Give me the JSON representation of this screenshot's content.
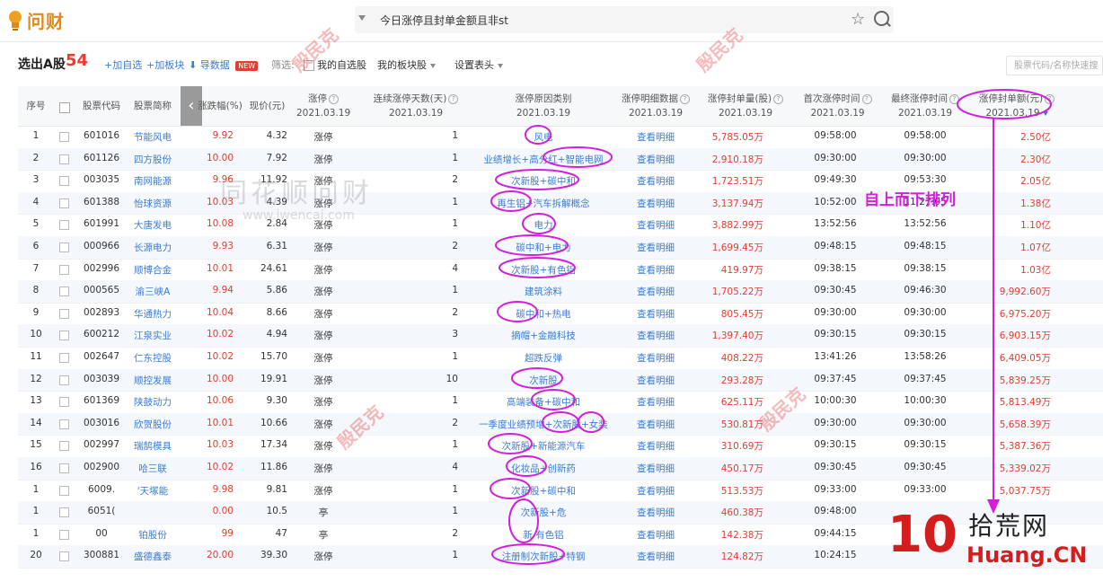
{
  "header": {
    "logo_text": "问财",
    "search_query": "今日涨停且封单金额且非st"
  },
  "toolbar": {
    "title": "选出A股",
    "count": "54",
    "add_watchlist": "+加自选",
    "add_block": "+加板块",
    "export": "导数据",
    "new_badge": "NEW",
    "filter_label": "筛选:",
    "my_watchlist": "我的自选股",
    "my_blocks": "我的板块股",
    "table_settings": "设置表头",
    "quick_search_placeholder": "股票代码/名称快速搜"
  },
  "columns": [
    {
      "label": "序号"
    },
    {
      "label": "股票代码"
    },
    {
      "label": "股票简称"
    },
    {
      "label": "涨跌幅(%)"
    },
    {
      "label": "现价(元)"
    },
    {
      "label": "涨停",
      "date": "2021.03.19"
    },
    {
      "label": "连续涨停天数(天)",
      "date": "2021.03.19"
    },
    {
      "label": "涨停原因类别",
      "date": "2021.03.19"
    },
    {
      "label": "涨停明细数据",
      "date": "2021.03.19"
    },
    {
      "label": "涨停封单量(股)",
      "date": "2021.03.19"
    },
    {
      "label": "首次涨停时间",
      "date": "2021.03.19"
    },
    {
      "label": "最终涨停时间",
      "date": "2021.03.19"
    },
    {
      "label": "涨停封单额(元)",
      "date": "2021.03.19"
    }
  ],
  "rows": [
    {
      "idx": "1",
      "code": "601016",
      "name": "节能风电",
      "chg": "9.92",
      "price": "4.32",
      "status": "涨停",
      "days": "1",
      "reason": "风电",
      "detail": "查看明细",
      "vol": "5,785.05万",
      "first": "09:58:00",
      "last": "09:58:00",
      "amount": "2.50亿"
    },
    {
      "idx": "2",
      "code": "601126",
      "name": "四方股份",
      "chg": "10.00",
      "price": "7.92",
      "status": "涨停",
      "days": "1",
      "reason": "业绩增长+高分红+智能电网",
      "detail": "查看明细",
      "vol": "2,910.18万",
      "first": "09:30:00",
      "last": "09:30:00",
      "amount": "2.30亿"
    },
    {
      "idx": "3",
      "code": "003035",
      "name": "南网能源",
      "chg": "9.96",
      "price": "11.92",
      "status": "涨停",
      "days": "2",
      "reason": "次新股+碳中和",
      "detail": "查看明细",
      "vol": "1,723.51万",
      "first": "09:49:30",
      "last": "09:53:30",
      "amount": "2.05亿"
    },
    {
      "idx": "4",
      "code": "601388",
      "name": "怡球资源",
      "chg": "10.03",
      "price": "4.39",
      "status": "涨停",
      "days": "1",
      "reason": "再生铝+汽车拆解概念",
      "detail": "查看明细",
      "vol": "3,137.94万",
      "first": "10:52:00",
      "last": "11:27:05",
      "amount": "1.38亿"
    },
    {
      "idx": "5",
      "code": "601991",
      "name": "大唐发电",
      "chg": "10.08",
      "price": "2.84",
      "status": "涨停",
      "days": "1",
      "reason": "电力",
      "detail": "查看明细",
      "vol": "3,882.99万",
      "first": "13:52:56",
      "last": "13:52:56",
      "amount": "1.10亿"
    },
    {
      "idx": "6",
      "code": "000966",
      "name": "长源电力",
      "chg": "9.93",
      "price": "6.31",
      "status": "涨停",
      "days": "2",
      "reason": "碳中和+电力",
      "detail": "查看明细",
      "vol": "1,699.45万",
      "first": "09:48:15",
      "last": "09:48:15",
      "amount": "1.07亿"
    },
    {
      "idx": "7",
      "code": "002996",
      "name": "顺博合金",
      "chg": "10.01",
      "price": "24.61",
      "status": "涨停",
      "days": "4",
      "reason": "次新股+有色铝",
      "detail": "查看明细",
      "vol": "419.97万",
      "first": "09:38:15",
      "last": "09:38:15",
      "amount": "1.03亿"
    },
    {
      "idx": "8",
      "code": "000565",
      "name": "渝三峡A",
      "chg": "9.94",
      "price": "5.86",
      "status": "涨停",
      "days": "1",
      "reason": "建筑涂料",
      "detail": "查看明细",
      "vol": "1,705.22万",
      "first": "09:30:45",
      "last": "09:46:30",
      "amount": "9,992.60万"
    },
    {
      "idx": "9",
      "code": "002893",
      "name": "华通热力",
      "chg": "10.04",
      "price": "8.66",
      "status": "涨停",
      "days": "2",
      "reason": "碳中和+热电",
      "detail": "查看明细",
      "vol": "805.45万",
      "first": "09:30:00",
      "last": "09:30:00",
      "amount": "6,975.20万"
    },
    {
      "idx": "10",
      "code": "600212",
      "name": "江泉实业",
      "chg": "10.02",
      "price": "4.94",
      "status": "涨停",
      "days": "3",
      "reason": "摘帽+金融科技",
      "detail": "查看明细",
      "vol": "1,397.40万",
      "first": "09:30:15",
      "last": "09:30:15",
      "amount": "6,903.15万"
    },
    {
      "idx": "11",
      "code": "002647",
      "name": "仁东控股",
      "chg": "10.02",
      "price": "15.70",
      "status": "涨停",
      "days": "1",
      "reason": "超跌反弹",
      "detail": "查看明细",
      "vol": "408.22万",
      "first": "13:41:26",
      "last": "13:58:26",
      "amount": "6,409.05万"
    },
    {
      "idx": "12",
      "code": "003039",
      "name": "顺控发展",
      "chg": "10.00",
      "price": "19.91",
      "status": "涨停",
      "days": "10",
      "reason": "次新股",
      "detail": "查看明细",
      "vol": "293.28万",
      "first": "09:37:45",
      "last": "09:37:45",
      "amount": "5,839.25万"
    },
    {
      "idx": "13",
      "code": "601369",
      "name": "陕鼓动力",
      "chg": "10.06",
      "price": "9.30",
      "status": "涨停",
      "days": "1",
      "reason": "高端装备+碳中和",
      "detail": "查看明细",
      "vol": "625.11万",
      "first": "10:00:30",
      "last": "10:00:30",
      "amount": "5,813.49万"
    },
    {
      "idx": "14",
      "code": "003016",
      "name": "欣贺股份",
      "chg": "10.01",
      "price": "10.66",
      "status": "涨停",
      "days": "2",
      "reason": "一季度业绩预增+次新股+女装",
      "detail": "查看明细",
      "vol": "530.81万",
      "first": "09:30:00",
      "last": "09:30:00",
      "amount": "5,658.39万"
    },
    {
      "idx": "15",
      "code": "002997",
      "name": "瑞鹄模具",
      "chg": "10.03",
      "price": "17.34",
      "status": "涨停",
      "days": "1",
      "reason": "次新股+新能源汽车",
      "detail": "查看明细",
      "vol": "310.69万",
      "first": "09:30:15",
      "last": "09:30:15",
      "amount": "5,387.36万"
    },
    {
      "idx": "16",
      "code": "002900",
      "name": "哈三联",
      "chg": "10.02",
      "price": "11.86",
      "status": "涨停",
      "days": "4",
      "reason": "化妆品+创新药",
      "detail": "查看明细",
      "vol": "450.17万",
      "first": "09:30:45",
      "last": "09:30:45",
      "amount": "5,339.02万"
    },
    {
      "idx": "1",
      "code": "6009.",
      "name": "'天塚能",
      "chg": "9.98",
      "price": "9.81",
      "status": "涨停",
      "days": "1",
      "reason": "次新股+碳中和",
      "detail": "查看明细",
      "vol": "513.53万",
      "first": "09:33:00",
      "last": "09:33:00",
      "amount": "5,037.75万"
    },
    {
      "idx": "1",
      "code": "6051(",
      "name": "",
      "chg": "0.00",
      "price": "10.5",
      "status": "亭",
      "days": "1",
      "reason": "次新股+危",
      "detail": "查看明细",
      "vol": "460.38万",
      "first": "09:48:00",
      "last": "",
      "amount": ""
    },
    {
      "idx": "1",
      "code": "00",
      "name": "铂股份",
      "chg": "99",
      "price": "47",
      "status": "亭",
      "days": "2",
      "reason": "新 有色铝",
      "detail": "查看明细",
      "vol": "142.38万",
      "first": "09:44:15",
      "last": "",
      "amount": ""
    },
    {
      "idx": "20",
      "code": "300881",
      "name": "盛德鑫泰",
      "chg": "20.00",
      "price": "39.30",
      "status": "涨停",
      "days": "1",
      "reason": "注册制次新股+特钢",
      "detail": "查看明细",
      "vol": "124.82万",
      "first": "10:24:15",
      "last": "",
      "amount": ""
    }
  ],
  "watermark": {
    "main": "同花顺问财",
    "url": "www.iwencai.com"
  },
  "annotation": "自上而下排列",
  "brand": {
    "number": "10",
    "cn": "拾荒网",
    "en": "Huang.CN"
  }
}
